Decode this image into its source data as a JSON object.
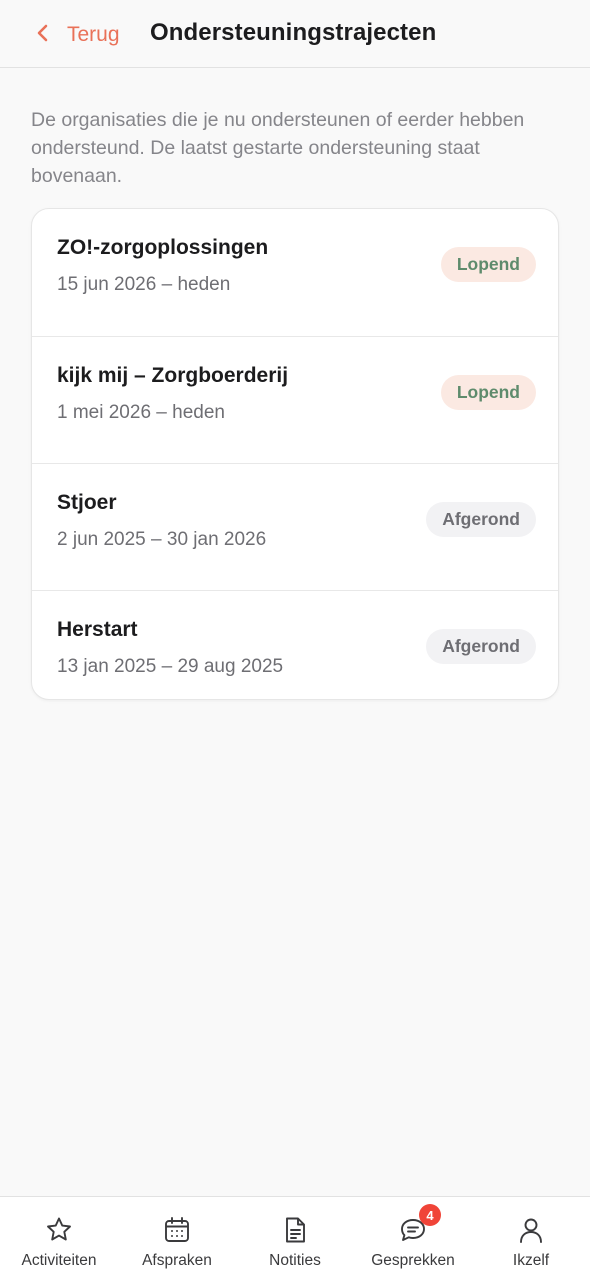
{
  "header": {
    "back_label": "Terug",
    "title": "Ondersteuningstrajecten"
  },
  "intro": "De organisaties die je nu ondersteunen of eerder hebben ondersteund. De laatst gestarte ondersteuning staat bovenaan.",
  "trajects": [
    {
      "name": "ZO!-zorgoplossingen",
      "dates": "15 jun 2026 – heden",
      "status": "Lopend"
    },
    {
      "name": "kijk mij – Zorgboerderij",
      "dates": "1 mei 2026 – heden",
      "status": "Lopend"
    },
    {
      "name": "Stjoer",
      "dates": "2 jun 2025 – 30 jan 2026",
      "status": "Afgerond"
    },
    {
      "name": "Herstart",
      "dates": "13 jan 2025 – 29 aug 2025",
      "status": "Afgerond"
    }
  ],
  "tabs": [
    {
      "label": "Activiteiten",
      "icon": "star-icon"
    },
    {
      "label": "Afspraken",
      "icon": "calendar-icon"
    },
    {
      "label": "Notities",
      "icon": "document-icon"
    },
    {
      "label": "Gesprekken",
      "icon": "chat-icon",
      "badge": "4"
    },
    {
      "label": "Ikzelf",
      "icon": "person-icon"
    }
  ],
  "colors": {
    "accent": "#e97158",
    "running_bg": "#fbe9e2",
    "running_text": "#5e8b6c",
    "done_bg": "#f2f2f4",
    "done_text": "#6e6e73",
    "badge_red": "#f04438"
  }
}
